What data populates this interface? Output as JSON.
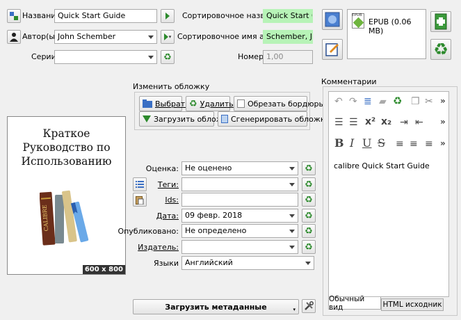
{
  "labels": {
    "title": "Название:",
    "author": "Автор(ы):",
    "series": "Серии:",
    "sort_title": "Сортировочное название:",
    "sort_author": "Сортировочное имя автора:",
    "number": "Номер:"
  },
  "values": {
    "title": "Quick Start Guide",
    "author": "John Schember",
    "series": "",
    "sort_title": "Quick Start Guide",
    "sort_author": "Schember, John",
    "number": "1,00"
  },
  "formats": {
    "badge": "EPUB",
    "name": "EPUB (0.06 MB)"
  },
  "cover_box": {
    "legend": "Изменить обложку",
    "browse": "Выбрать",
    "remove": "Удалить",
    "trim": "Обрезать бордюры",
    "download": "Загрузить обложку",
    "generate": "Сгенерировать обложку"
  },
  "cover": {
    "line1": "Краткое",
    "line2": "Руководство по",
    "line3": "Использованию",
    "size": "600 x 800",
    "book_spine": "CALIBRE"
  },
  "meta": {
    "rating_label": "Оценка:",
    "rating_value": "Не оценено",
    "tags_label": "Теги:",
    "tags_value": "",
    "ids_label": "Ids:",
    "ids_value": "",
    "date_label": "Дата:",
    "date_value": "09 февр. 2018",
    "published_label": "Опубликовано:",
    "published_value": "Не определено",
    "publisher_label": "Издатель:",
    "publisher_value": "",
    "languages_label": "Языки",
    "languages_value": "Английский"
  },
  "download_metadata": "Загрузить метаданные",
  "comments": {
    "legend": "Комментарии",
    "text": "calibre Quick Start Guide",
    "tab_normal": "Обычный вид",
    "tab_html": "HTML исходник"
  },
  "colors": {
    "green_field": "#b7f3b7",
    "recycle_green": "#2c8a2c"
  }
}
